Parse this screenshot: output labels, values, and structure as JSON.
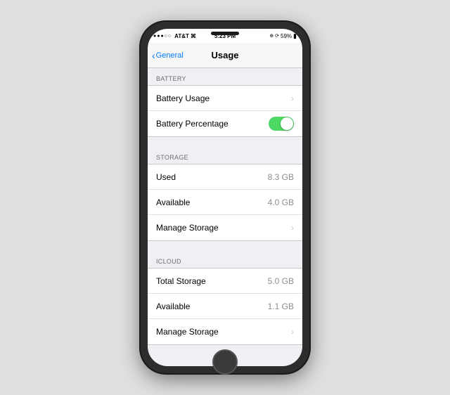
{
  "statusBar": {
    "carrier": "AT&T",
    "signal": "●●●○○",
    "wifi": "wifi",
    "time": "5:23 PM",
    "location": "⊕",
    "battery": "59%"
  },
  "navBar": {
    "backLabel": "General",
    "title": "Usage"
  },
  "sections": [
    {
      "id": "battery",
      "header": "BATTERY",
      "items": [
        {
          "id": "battery-usage",
          "label": "Battery Usage",
          "value": "",
          "type": "chevron"
        },
        {
          "id": "battery-percentage",
          "label": "Battery Percentage",
          "value": "",
          "type": "toggle"
        }
      ]
    },
    {
      "id": "storage",
      "header": "STORAGE",
      "items": [
        {
          "id": "storage-used",
          "label": "Used",
          "value": "8.3 GB",
          "type": "value"
        },
        {
          "id": "storage-available",
          "label": "Available",
          "value": "4.0 GB",
          "type": "value"
        },
        {
          "id": "storage-manage",
          "label": "Manage Storage",
          "value": "",
          "type": "chevron"
        }
      ]
    },
    {
      "id": "icloud",
      "header": "ICLOUD",
      "items": [
        {
          "id": "icloud-total",
          "label": "Total Storage",
          "value": "5.0 GB",
          "type": "value"
        },
        {
          "id": "icloud-available",
          "label": "Available",
          "value": "1.1 GB",
          "type": "value"
        },
        {
          "id": "icloud-manage",
          "label": "Manage Storage",
          "value": "",
          "type": "chevron"
        }
      ]
    }
  ],
  "icons": {
    "chevron": "›",
    "back_chevron": "‹"
  }
}
